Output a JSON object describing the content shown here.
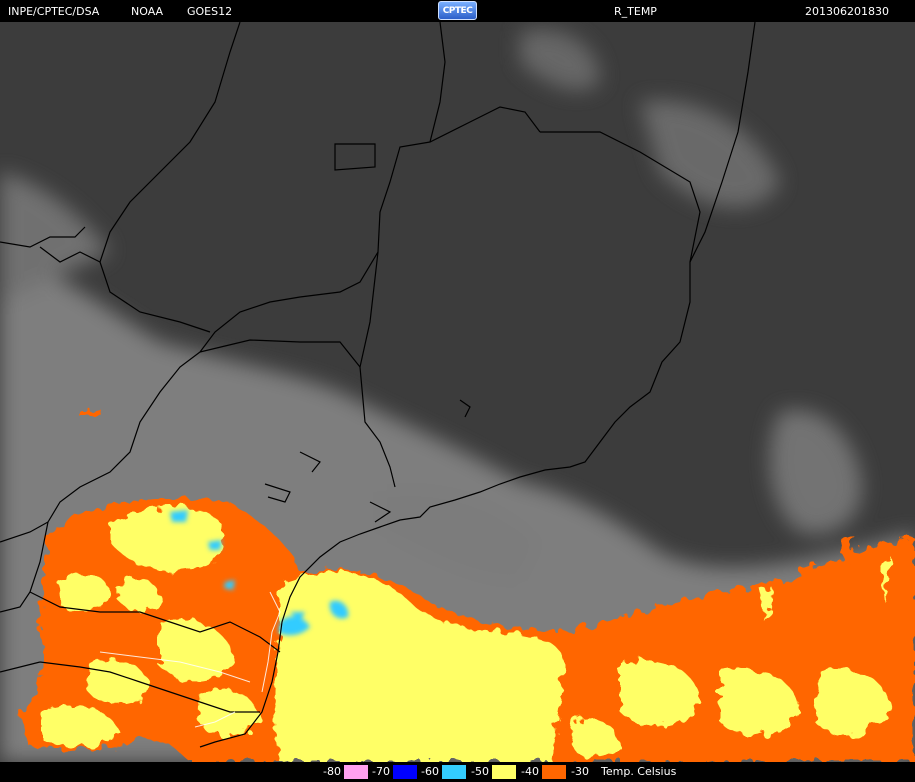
{
  "header": {
    "agency": "INPE/CPTEC/DSA",
    "source": "NOAA",
    "satellite": "GOES12",
    "logo_text": "CPTEC",
    "product": "R_TEMP",
    "timestamp": "201306201830"
  },
  "map": {
    "background_color": "#3a3a3a",
    "cloud_color": "#8c8c8c",
    "border_color": "#000000"
  },
  "legend": {
    "unit": "Temp. Celsius",
    "items": [
      {
        "label": "-80",
        "color": "#ffa0f0"
      },
      {
        "label": "-70",
        "color": "#0000ff"
      },
      {
        "label": "-60",
        "color": "#33ccff"
      },
      {
        "label": "-50",
        "color": "#ffff66"
      },
      {
        "label": "-40",
        "color": "#ff6600"
      },
      {
        "label": "-30",
        "color": "#ff6600"
      }
    ]
  }
}
